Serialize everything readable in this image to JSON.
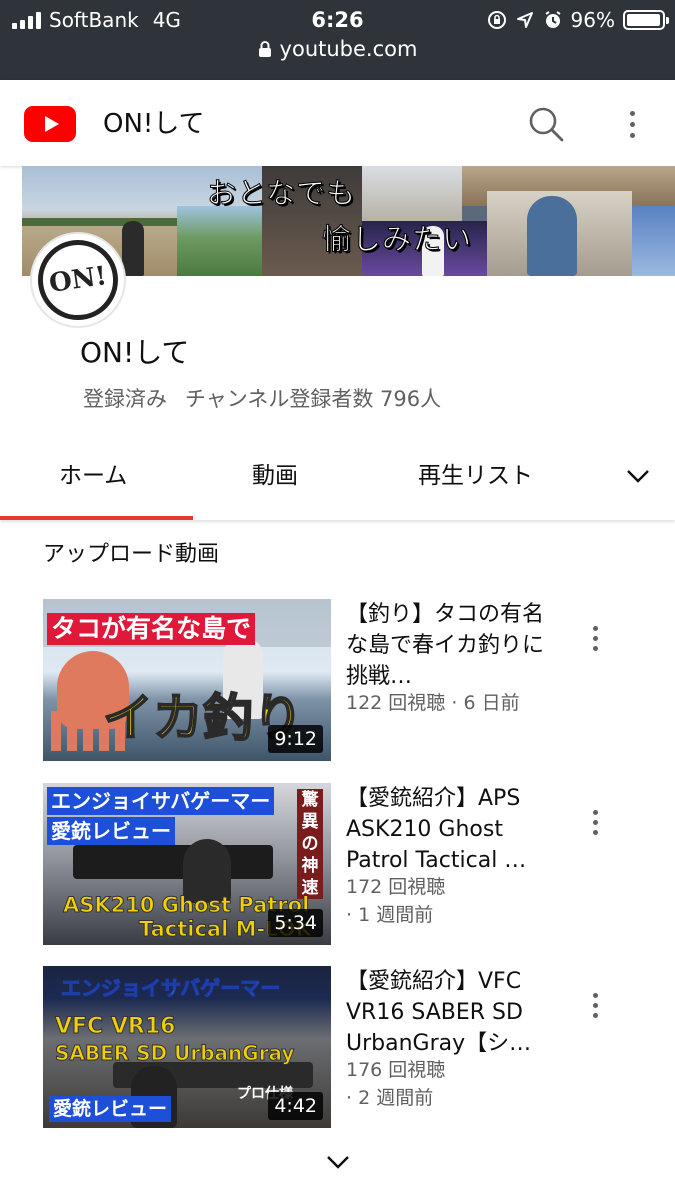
{
  "status_bar": {
    "carrier": "SoftBank",
    "network": "4G",
    "time": "6:26",
    "battery": "96%",
    "battery_level": 0.96,
    "icons": [
      "signal-bars-icon",
      "rotation-lock-icon",
      "location-arrow-icon",
      "alarm-icon",
      "battery-icon"
    ]
  },
  "browser": {
    "url": "youtube.com",
    "lock_icon": "lock-icon"
  },
  "header": {
    "logo": "youtube-logo-icon",
    "title": "ON!して",
    "search_icon": "search-icon",
    "more_icon": "more-vert-icon"
  },
  "banner": {
    "line1": "おとなでも",
    "line2": "愉しみたい"
  },
  "channel": {
    "avatar_text": "ON!",
    "name": "ON!して",
    "subscribed_label": "登録済み",
    "subscriber_count": "チャンネル登録者数 796人"
  },
  "tabs": [
    {
      "label": "ホーム",
      "active": true
    },
    {
      "label": "動画",
      "active": false
    },
    {
      "label": "再生リスト",
      "active": false
    }
  ],
  "tabs_more_icon": "chevron-down-icon",
  "section": {
    "title": "アップロード動画"
  },
  "videos": [
    {
      "title": "【釣り】タコの有名な島で春イカ釣りに挑戦…",
      "views": "122 回視聴",
      "age": "· 6 日前",
      "duration": "9:12",
      "thumb_text_top": "タコが有名な島で",
      "thumb_text_main": "イカ釣り"
    },
    {
      "title": "【愛銃紹介】APS ASK210 Ghost Patrol Tactical …",
      "views": "172 回視聴",
      "age": "· 1 週間前",
      "duration": "5:34",
      "thumb_text_top": "エンジョイサバゲーマー",
      "thumb_text_sub": "愛銃レビュー",
      "thumb_text_side": "驚異の神速",
      "thumb_text_main": "ASK210 Ghost Patrol",
      "thumb_text_main2": "Tactical M-LOK"
    },
    {
      "title": "【愛銃紹介】VFC VR16 SABER SD UrbanGray【シ…",
      "views": "176 回視聴",
      "age": "· 2 週間前",
      "duration": "4:42",
      "thumb_text_top": "エンジョイサバゲーマー",
      "thumb_text_main": "VFC VR16",
      "thumb_text_main2": "SABER SD UrbanGray",
      "thumb_text_sub": "愛銃レビュー",
      "thumb_text_side": "プロ仕様"
    }
  ],
  "load_more_icon": "chevron-down-icon"
}
